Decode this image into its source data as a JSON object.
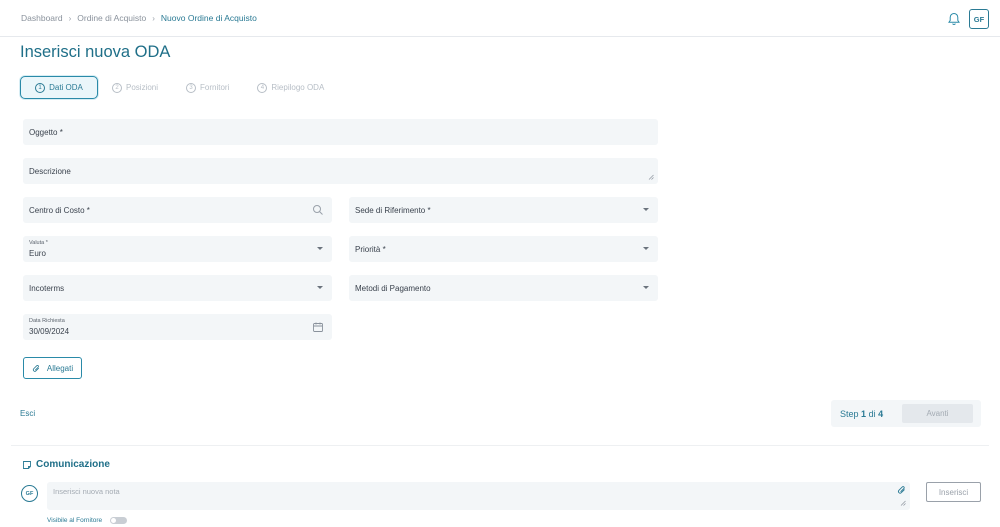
{
  "breadcrumb": [
    "Dashboard",
    "Ordine di Acquisto",
    "Nuovo Ordine di Acquisto"
  ],
  "header": {
    "user_initials": "GF"
  },
  "page": {
    "title": "Inserisci nuova ODA"
  },
  "steps": [
    {
      "num": "1",
      "label": "Dati ODA",
      "active": true
    },
    {
      "num": "2",
      "label": "Posizioni",
      "active": false
    },
    {
      "num": "3",
      "label": "Fornitori",
      "active": false
    },
    {
      "num": "4",
      "label": "Riepilogo ODA",
      "active": false
    }
  ],
  "form": {
    "oggetto": "Oggetto *",
    "descrizione": "Descrizione",
    "centro_costo": "Centro di Costo *",
    "sede": "Sede di Riferimento *",
    "valuta_label": "Valuta *",
    "valuta_value": "Euro",
    "priorita": "Priorità *",
    "incoterms": "Incoterms",
    "metodi_pagamento": "Metodi di Pagamento",
    "data_label": "Data Richiesta",
    "data_value": "30/09/2024",
    "allegati": "Allegati"
  },
  "footer": {
    "exit": "Esci",
    "step_word": "Step",
    "step_current": "1",
    "step_of": "di",
    "step_total": "4",
    "next": "Avanti"
  },
  "communication": {
    "title": "Comunicazione",
    "avatar": "GF",
    "note_placeholder": "Inserisci nuova nota",
    "insert": "Inserisci",
    "visible_label": "Visibile al Fornitore"
  },
  "colors": {
    "accent": "#2a7a94",
    "field_bg": "#f3f6f8"
  }
}
